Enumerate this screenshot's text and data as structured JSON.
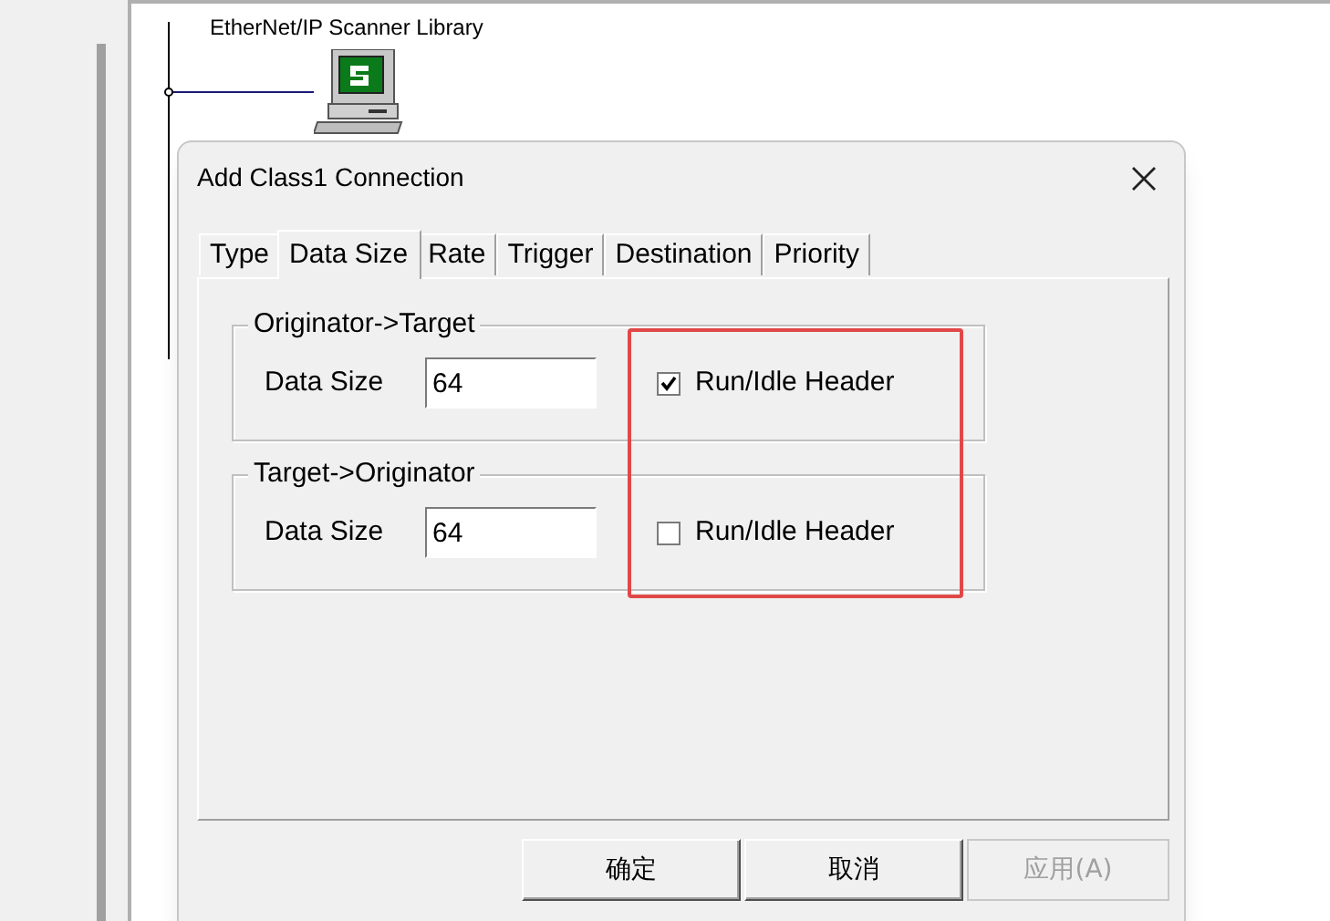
{
  "canvas": {
    "node_label": "EtherNet/IP Scanner Library"
  },
  "dialog": {
    "title": "Add Class1 Connection",
    "tabs": [
      {
        "label": "Type",
        "selected": false
      },
      {
        "label": "Data Size",
        "selected": true
      },
      {
        "label": "Rate",
        "selected": false
      },
      {
        "label": "Trigger",
        "selected": false
      },
      {
        "label": "Destination",
        "selected": false
      },
      {
        "label": "Priority",
        "selected": false
      }
    ],
    "groups": [
      {
        "title": "Originator->Target",
        "field_label": "Data Size",
        "value": "64",
        "checkbox_label": "Run/Idle Header",
        "checked": true
      },
      {
        "title": "Target->Originator",
        "field_label": "Data Size",
        "value": "64",
        "checkbox_label": "Run/Idle Header",
        "checked": false
      }
    ],
    "buttons": [
      {
        "label": "确定",
        "disabled": false
      },
      {
        "label": "取消",
        "disabled": false
      },
      {
        "label": "应用(A)",
        "disabled": true
      }
    ]
  }
}
